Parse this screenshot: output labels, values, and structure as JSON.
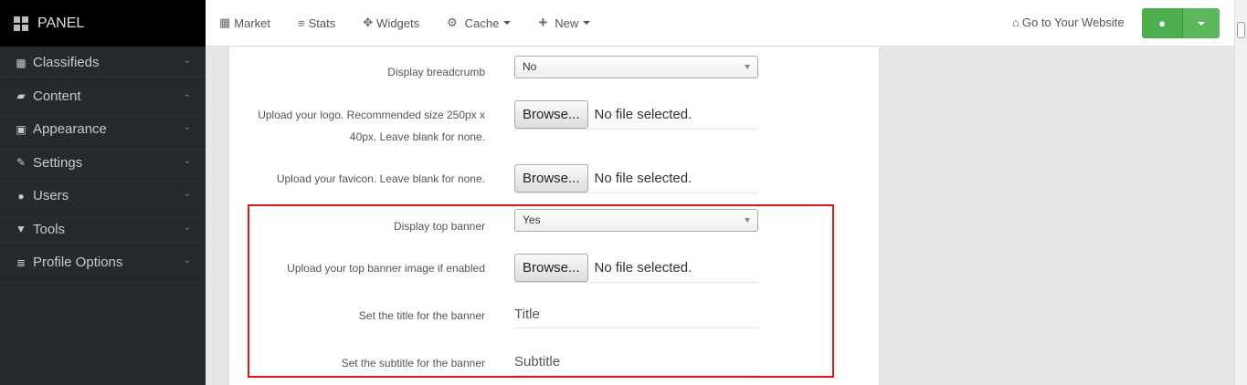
{
  "brand": {
    "title": "PANEL"
  },
  "sidebar": {
    "items": [
      {
        "label": "Classifieds",
        "icon": "grid-icon"
      },
      {
        "label": "Content",
        "icon": "folder-open-icon"
      },
      {
        "label": "Appearance",
        "icon": "picture-icon"
      },
      {
        "label": "Settings",
        "icon": "wrench-icon"
      },
      {
        "label": "Users",
        "icon": "user-icon"
      },
      {
        "label": "Tools",
        "icon": "filter-icon"
      },
      {
        "label": "Profile Options",
        "icon": "list-icon"
      }
    ]
  },
  "topnav": {
    "market": "Market",
    "stats": "Stats",
    "widgets": "Widgets",
    "cache": "Cache",
    "new": "New",
    "go_site": "Go to Your Website"
  },
  "form": {
    "breadcrumb_label": "Display breadcrumb",
    "breadcrumb_value": "No",
    "logo_label_1": "Upload your logo. Recommended size 250px x",
    "logo_label_2": "40px. Leave blank for none.",
    "favicon_label": "Upload your favicon. Leave blank for none.",
    "browse_label": "Browse...",
    "no_file": "No file selected.",
    "top_banner_label": "Display top banner",
    "top_banner_value": "Yes",
    "banner_image_label": "Upload your top banner image if enabled",
    "banner_title_label": "Set the title for the banner",
    "banner_title_placeholder": "Title",
    "banner_subtitle_label": "Set the subtitle for the banner",
    "banner_subtitle_placeholder": "Subtitle"
  },
  "colors": {
    "highlight": "#d9141a",
    "sidebar": "#26292e",
    "success": "#5cb85c"
  }
}
